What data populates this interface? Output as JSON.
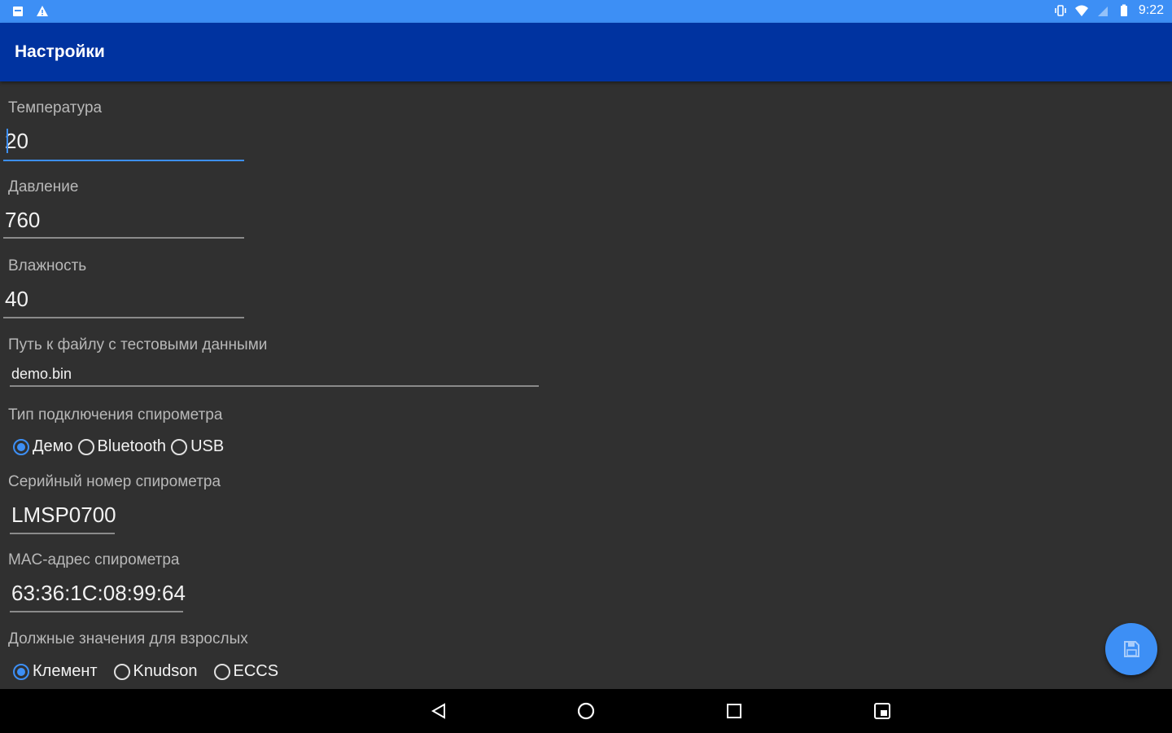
{
  "status_bar": {
    "time": "9:22",
    "left_icons": [
      "notification-icon",
      "warning-icon"
    ],
    "right_icons": [
      "vibrate-icon",
      "wifi-icon",
      "signal-icon",
      "battery-icon"
    ]
  },
  "app_bar": {
    "title": "Настройки"
  },
  "settings": {
    "temperature": {
      "label": "Температура",
      "value": "20"
    },
    "pressure": {
      "label": "Давление",
      "value": "760"
    },
    "humidity": {
      "label": "Влажность",
      "value": "40"
    },
    "test_file": {
      "label": "Путь к файлу с тестовыми данными",
      "value": "demo.bin"
    },
    "connection_type": {
      "label": "Тип подключения спирометра",
      "options": [
        "Демо",
        "Bluetooth",
        "USB"
      ],
      "selected": "Демо"
    },
    "serial_number": {
      "label": "Серийный номер спирометра",
      "value": "LMSP0700"
    },
    "mac_address": {
      "label": "MAC-адрес спирометра",
      "value": "63:36:1C:08:99:64"
    },
    "adult_norms": {
      "label": "Должные значения для взрослых",
      "options": [
        "Клемент",
        "Knudson",
        "ECCS"
      ],
      "selected": "Клемент"
    }
  },
  "fab": {
    "icon": "save-icon"
  },
  "nav_bar": {
    "icons": [
      "back-icon",
      "home-icon",
      "recents-icon",
      "screenshot-icon"
    ]
  },
  "colors": {
    "accent": "#3d8ff5",
    "app_bar": "#0033a0",
    "background": "#303030"
  }
}
